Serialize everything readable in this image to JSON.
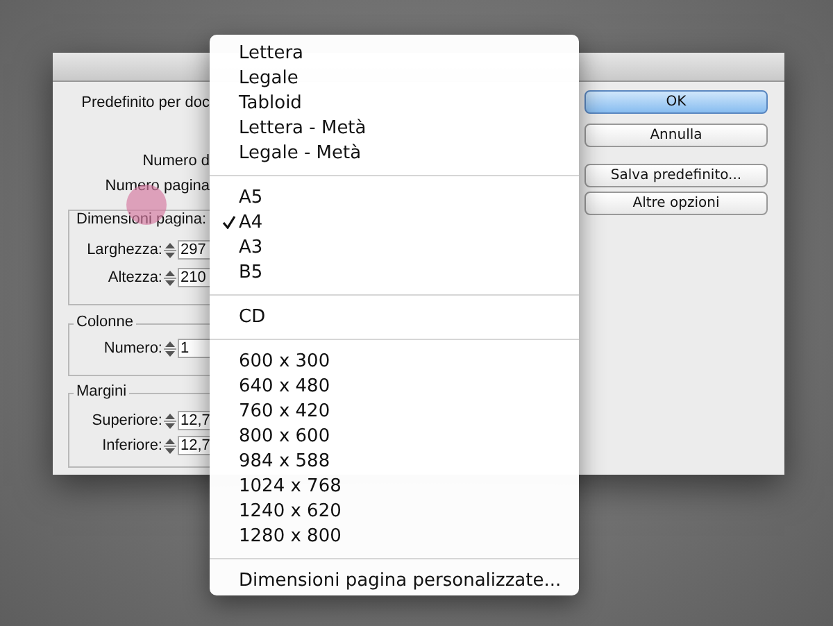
{
  "dialog": {
    "preset_label": "Predefinito per doc",
    "pages_label": "Numero d",
    "start_label": "Numero pagina",
    "groups": [
      {
        "title": "Dimensioni pagina:",
        "fields": [
          {
            "label": "Larghezza:",
            "value": "297"
          },
          {
            "label": "Altezza:",
            "value": "210"
          }
        ]
      },
      {
        "title": "Colonne",
        "fields": [
          {
            "label": "Numero:",
            "value": "1"
          }
        ]
      },
      {
        "title": "Margini",
        "fields": [
          {
            "label": "Superiore:",
            "value": "12,7"
          },
          {
            "label": "Inferiore:",
            "value": "12,7"
          }
        ]
      }
    ],
    "buttons": [
      {
        "label": "OK",
        "kind": "default"
      },
      {
        "label": "Annulla",
        "kind": "normal"
      },
      {
        "label": "Salva predefinito...",
        "kind": "normal"
      },
      {
        "label": "Altre opzioni",
        "kind": "normal"
      }
    ]
  },
  "menu": {
    "sections": [
      {
        "items": [
          {
            "label": "Lettera",
            "checked": false
          },
          {
            "label": "Legale",
            "checked": false
          },
          {
            "label": "Tabloid",
            "checked": false
          },
          {
            "label": "Lettera - Metà",
            "checked": false
          },
          {
            "label": "Legale - Metà",
            "checked": false
          }
        ]
      },
      {
        "items": [
          {
            "label": "A5",
            "checked": false
          },
          {
            "label": "A4",
            "checked": true
          },
          {
            "label": "A3",
            "checked": false
          },
          {
            "label": "B5",
            "checked": false
          }
        ]
      },
      {
        "items": [
          {
            "label": "CD",
            "checked": false
          }
        ]
      },
      {
        "items": [
          {
            "label": "600 x 300",
            "checked": false
          },
          {
            "label": "640 x 480",
            "checked": false
          },
          {
            "label": "760 x 420",
            "checked": false
          },
          {
            "label": "800 x 600",
            "checked": false
          },
          {
            "label": "984 x 588",
            "checked": false
          },
          {
            "label": "1024 x 768",
            "checked": false
          },
          {
            "label": "1240 x 620",
            "checked": false
          },
          {
            "label": "1280 x 800",
            "checked": false
          }
        ]
      },
      {
        "items": [
          {
            "label": "Dimensioni pagina personalizzate...",
            "checked": false
          }
        ]
      }
    ]
  }
}
